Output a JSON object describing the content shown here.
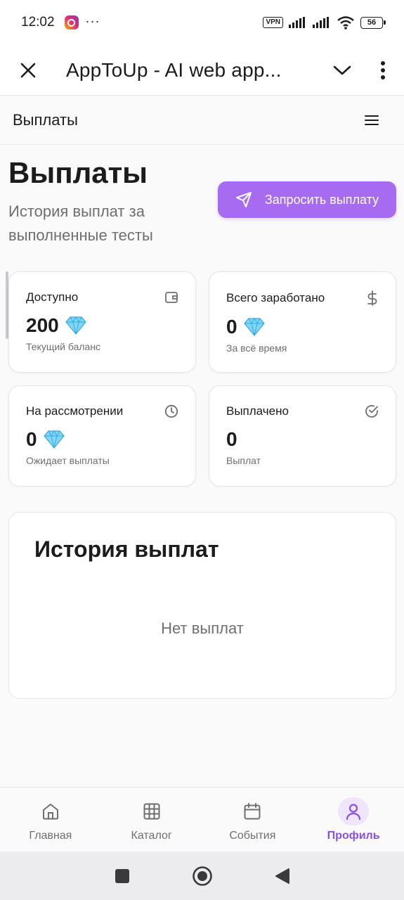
{
  "status_bar": {
    "time": "12:02",
    "dots": "···",
    "vpn": "VPN",
    "battery": "56"
  },
  "app_header": {
    "title": "AppToUp - AI web app..."
  },
  "page_bar": {
    "title": "Выплаты"
  },
  "main": {
    "title": "Выплаты",
    "subtitle": "История выплат за выполненные тесты",
    "request_button": "Запросить выплату"
  },
  "cards": [
    {
      "label": "Доступно",
      "value": "200",
      "note": "Текущий баланс",
      "icon": "wallet-icon",
      "gem": true
    },
    {
      "label": "Всего заработано",
      "value": "0",
      "note": "За всё время",
      "icon": "dollar-icon",
      "gem": true
    },
    {
      "label": "На рассмотрении",
      "value": "0",
      "note": "Ожидает выплаты",
      "icon": "clock-icon",
      "gem": true
    },
    {
      "label": "Выплачено",
      "value": "0",
      "note": "Выплат",
      "icon": "check-circle-icon",
      "gem": false
    }
  ],
  "history": {
    "title": "История выплат",
    "empty": "Нет выплат"
  },
  "bottom_nav": [
    {
      "label": "Главная",
      "icon": "home-icon",
      "active": false
    },
    {
      "label": "Каталог",
      "icon": "grid-icon",
      "active": false
    },
    {
      "label": "События",
      "icon": "calendar-icon",
      "active": false
    },
    {
      "label": "Профиль",
      "icon": "user-icon",
      "active": true
    }
  ],
  "colors": {
    "accent": "#a66bf0",
    "accent_text": "#8a4fe0",
    "gem": "#5ec8f2"
  }
}
